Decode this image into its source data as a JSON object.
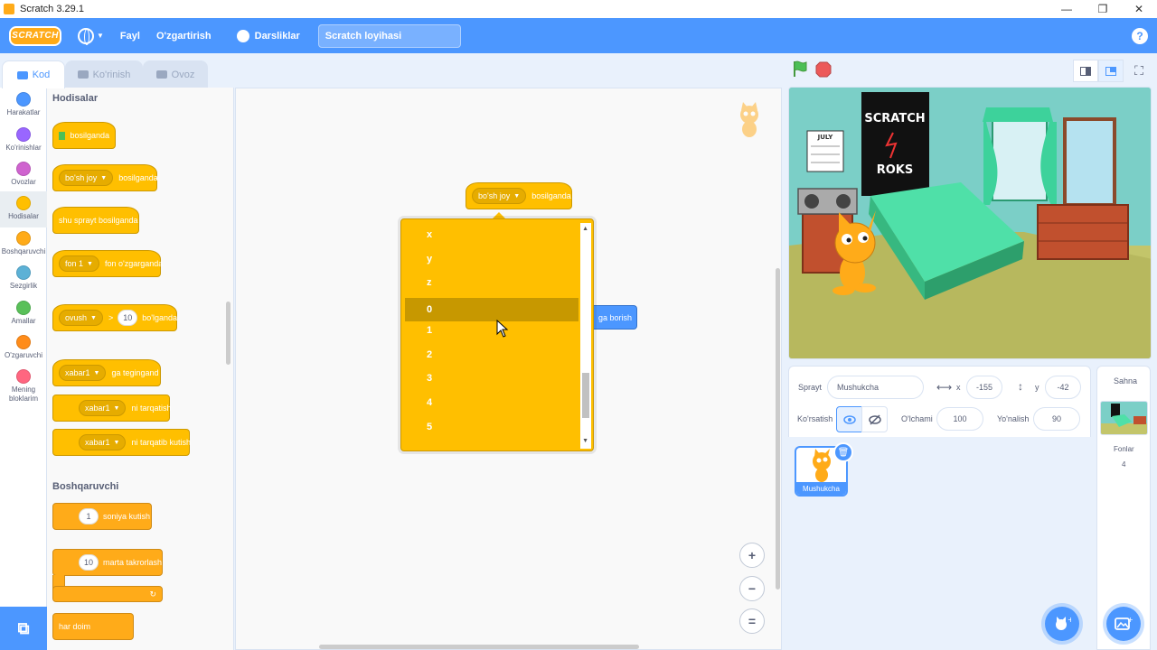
{
  "window": {
    "title": "Scratch 3.29.1",
    "minimize": "—",
    "maximize": "❐",
    "close": "✕"
  },
  "menubar": {
    "logo": "SCRATCH",
    "file": "Fayl",
    "edit": "O'zgartirish",
    "tutorials": "Darsliklar",
    "project_title": "Scratch loyihasi",
    "help": "?"
  },
  "tabs": {
    "code": "Kod",
    "costumes": "Ko'rinish",
    "sounds": "Ovoz"
  },
  "categories": [
    {
      "label": "Harakatlar",
      "color": "#4c97ff"
    },
    {
      "label": "Ko'rinishlar",
      "color": "#9966ff"
    },
    {
      "label": "Ovozlar",
      "color": "#cf63cf"
    },
    {
      "label": "Hodisalar",
      "color": "#ffbf00"
    },
    {
      "label": "Boshqaruvchi",
      "color": "#ffab19"
    },
    {
      "label": "Sezgirlik",
      "color": "#5cb1d6"
    },
    {
      "label": "Amallar",
      "color": "#59c059"
    },
    {
      "label": "O'zgaruvchi",
      "color": "#ff8c1a"
    },
    {
      "label": "Mening bloklarim",
      "color": "#ff6680"
    }
  ],
  "palette": {
    "events_title": "Hodisalar",
    "control_title": "Boshqaruvchi",
    "flag_clicked": "bosilganda",
    "key_dd": "bo'sh joy",
    "key_suffix": "bosilganda",
    "sprite_clicked": "shu sprayt bosilganda",
    "backdrop_dd": "fon 1",
    "backdrop_suffix": "fon o'zgarganda",
    "loudness_dd": "ovush",
    "gt": ">",
    "loudness_val": "10",
    "loudness_suffix": "bo'lganda",
    "msg_dd": "xabar1",
    "receive_suffix": "ga tegingand",
    "broadcast_suffix": "ni tarqatish",
    "broadcast_wait_suffix": "ni tarqatib kutish",
    "wait_val": "1",
    "wait_suffix": "soniya kutish",
    "repeat_val": "10",
    "repeat_suffix": "marta takrorlash",
    "forever": "har doim"
  },
  "workspace": {
    "hat_dd": "bo'sh joy",
    "hat_suffix": "bosilganda",
    "blue_block": "ga borish"
  },
  "dropdown": {
    "options": [
      "x",
      "y",
      "z",
      "0",
      "1",
      "2",
      "3",
      "4",
      "5"
    ],
    "highlighted": "0"
  },
  "zoom": {
    "in": "+",
    "out": "−",
    "reset": "="
  },
  "sprite_info": {
    "sprite_label": "Sprayt",
    "sprite_name": "Mushukcha",
    "x_label": "x",
    "x_value": "-155",
    "y_label": "y",
    "y_value": "-42",
    "show_label": "Ko'rsatish",
    "size_label": "O'lchami",
    "size_value": "100",
    "direction_label": "Yo'nalish",
    "direction_value": "90"
  },
  "sprites": [
    {
      "name": "Mushukcha"
    }
  ],
  "stage_target": {
    "title": "Sahna",
    "backdrops_label": "Fonlar",
    "backdrops_count": "4"
  },
  "stage_poster": {
    "line1": "SCRATCH",
    "line2": "ROKS",
    "calendar": "JULY"
  },
  "colors": {
    "accent": "#4c97ff",
    "events": "#ffbf00",
    "control": "#ffab19",
    "menubar": "#4c97ff"
  }
}
